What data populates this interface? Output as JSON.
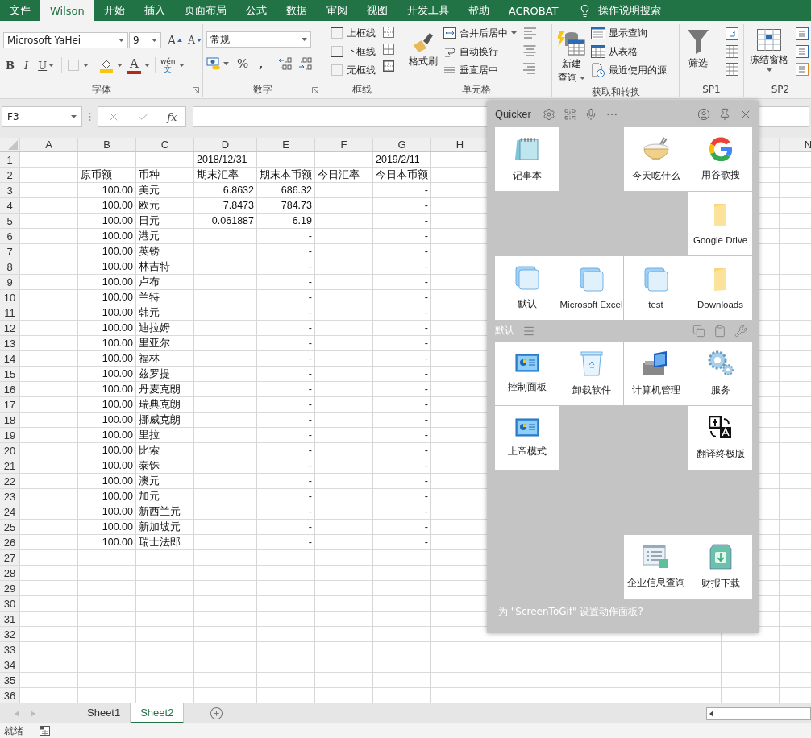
{
  "ribbon_tabs": [
    {
      "label": "文件",
      "selected": false
    },
    {
      "label": "Wilson",
      "selected": true
    },
    {
      "label": "开始",
      "selected": false
    },
    {
      "label": "插入",
      "selected": false
    },
    {
      "label": "页面布局",
      "selected": false
    },
    {
      "label": "公式",
      "selected": false
    },
    {
      "label": "数据",
      "selected": false
    },
    {
      "label": "审阅",
      "selected": false
    },
    {
      "label": "视图",
      "selected": false
    },
    {
      "label": "开发工具",
      "selected": false
    },
    {
      "label": "帮助",
      "selected": false
    },
    {
      "label": "ACROBAT",
      "selected": false
    }
  ],
  "tell_me": "操作说明搜索",
  "font_group": {
    "label": "字体",
    "font_name": "Microsoft YaHei",
    "font_size": "9",
    "grow": "A",
    "shrink": "A",
    "bold": "B",
    "italic": "I",
    "underline": "U",
    "font_color": "A",
    "phonetic": [
      "wén",
      "文"
    ]
  },
  "number_group": {
    "label": "数字",
    "format": "常规",
    "percent": "%",
    "comma": ","
  },
  "border_group": {
    "label": "框线",
    "items": [
      "上框线",
      "下框线",
      "无框线"
    ]
  },
  "cells_group": {
    "label": "单元格",
    "format_painter": "格式刷",
    "items": [
      "合并后居中",
      "自动换行",
      "垂直居中"
    ]
  },
  "get_transform_group": {
    "label": "获取和转换",
    "new_query": [
      "新建",
      "查询"
    ],
    "items": [
      "显示查询",
      "从表格",
      "最近使用的源"
    ]
  },
  "sp1_group": {
    "label": "SP1",
    "filter": "筛选"
  },
  "sp2_group": {
    "label": "SP2",
    "freeze": "冻结窗格"
  },
  "formula_bar": {
    "name_box": "F3",
    "function_label": "fx"
  },
  "grid": {
    "columns": [
      "A",
      "B",
      "C",
      "D",
      "E",
      "F",
      "G",
      "H",
      "N"
    ],
    "rows": [
      {
        "n": "1",
        "kind": "header",
        "cells": {
          "D": "2018/12/31",
          "G": "2019/2/11"
        }
      },
      {
        "n": "2",
        "kind": "header",
        "cells": {
          "B": "原币额",
          "C": "币种",
          "D": "期末汇率",
          "E": "期末本币额",
          "F": "今日汇率",
          "G": "今日本币额"
        }
      },
      {
        "n": "3",
        "kind": "data",
        "cells": {
          "B": "100.00",
          "C": "美元",
          "D": "6.8632",
          "E": "686.32",
          "G": "-"
        }
      },
      {
        "n": "4",
        "kind": "data",
        "cells": {
          "B": "100.00",
          "C": "欧元",
          "D": "7.8473",
          "E": "784.73",
          "G": "-"
        }
      },
      {
        "n": "5",
        "kind": "data",
        "cells": {
          "B": "100.00",
          "C": "日元",
          "D": "0.061887",
          "E": "6.19",
          "G": "-"
        }
      },
      {
        "n": "6",
        "kind": "data",
        "cells": {
          "B": "100.00",
          "C": "港元",
          "E": "-",
          "G": "-"
        }
      },
      {
        "n": "7",
        "kind": "data",
        "cells": {
          "B": "100.00",
          "C": "英镑",
          "E": "-",
          "G": "-"
        }
      },
      {
        "n": "8",
        "kind": "data",
        "cells": {
          "B": "100.00",
          "C": "林吉特",
          "E": "-",
          "G": "-"
        }
      },
      {
        "n": "9",
        "kind": "data",
        "cells": {
          "B": "100.00",
          "C": "卢布",
          "E": "-",
          "G": "-"
        }
      },
      {
        "n": "10",
        "kind": "data",
        "cells": {
          "B": "100.00",
          "C": "兰特",
          "E": "-",
          "G": "-"
        }
      },
      {
        "n": "11",
        "kind": "data",
        "cells": {
          "B": "100.00",
          "C": "韩元",
          "E": "-",
          "G": "-"
        }
      },
      {
        "n": "12",
        "kind": "data",
        "cells": {
          "B": "100.00",
          "C": "迪拉姆",
          "E": "-",
          "G": "-"
        }
      },
      {
        "n": "13",
        "kind": "data",
        "cells": {
          "B": "100.00",
          "C": "里亚尔",
          "E": "-",
          "G": "-"
        }
      },
      {
        "n": "14",
        "kind": "data",
        "cells": {
          "B": "100.00",
          "C": "福林",
          "E": "-",
          "G": "-"
        }
      },
      {
        "n": "15",
        "kind": "data",
        "cells": {
          "B": "100.00",
          "C": "兹罗提",
          "E": "-",
          "G": "-"
        }
      },
      {
        "n": "16",
        "kind": "data",
        "cells": {
          "B": "100.00",
          "C": "丹麦克朗",
          "E": "-",
          "G": "-"
        }
      },
      {
        "n": "17",
        "kind": "data",
        "cells": {
          "B": "100.00",
          "C": "瑞典克朗",
          "E": "-",
          "G": "-"
        }
      },
      {
        "n": "18",
        "kind": "data",
        "cells": {
          "B": "100.00",
          "C": "挪威克朗",
          "E": "-",
          "G": "-"
        }
      },
      {
        "n": "19",
        "kind": "data",
        "cells": {
          "B": "100.00",
          "C": "里拉",
          "E": "-",
          "G": "-"
        }
      },
      {
        "n": "20",
        "kind": "data",
        "cells": {
          "B": "100.00",
          "C": "比索",
          "E": "-",
          "G": "-"
        }
      },
      {
        "n": "21",
        "kind": "data",
        "cells": {
          "B": "100.00",
          "C": "泰铢",
          "E": "-",
          "G": "-"
        }
      },
      {
        "n": "22",
        "kind": "data",
        "cells": {
          "B": "100.00",
          "C": "澳元",
          "E": "-",
          "G": "-"
        }
      },
      {
        "n": "23",
        "kind": "data",
        "cells": {
          "B": "100.00",
          "C": "加元",
          "E": "-",
          "G": "-"
        }
      },
      {
        "n": "24",
        "kind": "data",
        "cells": {
          "B": "100.00",
          "C": "新西兰元",
          "E": "-",
          "G": "-"
        }
      },
      {
        "n": "25",
        "kind": "data",
        "cells": {
          "B": "100.00",
          "C": "新加坡元",
          "E": "-",
          "G": "-"
        }
      },
      {
        "n": "26",
        "kind": "data",
        "cells": {
          "B": "100.00",
          "C": "瑞士法郎",
          "E": "-",
          "G": "-"
        }
      },
      {
        "n": "27"
      },
      {
        "n": "28"
      },
      {
        "n": "29"
      },
      {
        "n": "30"
      },
      {
        "n": "31"
      },
      {
        "n": "32"
      },
      {
        "n": "33"
      },
      {
        "n": "34"
      },
      {
        "n": "35"
      },
      {
        "n": "36"
      }
    ]
  },
  "sheet_tabs": [
    {
      "label": "Sheet1",
      "selected": false
    },
    {
      "label": "Sheet2",
      "selected": true
    }
  ],
  "status": "就绪",
  "quicker": {
    "title": "Quicker",
    "top_tiles": [
      {
        "kind": "action",
        "label": "记事本"
      },
      {
        "kind": "empty"
      },
      {
        "kind": "action",
        "label": "今天吃什么"
      },
      {
        "kind": "action",
        "label": "用谷歌搜"
      },
      {
        "kind": "empty"
      },
      {
        "kind": "empty"
      },
      {
        "kind": "empty"
      },
      {
        "kind": "action",
        "label": "Google Drive"
      },
      {
        "kind": "action",
        "label": "默认"
      },
      {
        "kind": "action",
        "label": "Microsoft Excel"
      },
      {
        "kind": "action",
        "label": "test"
      },
      {
        "kind": "action",
        "label": "Downloads"
      }
    ],
    "section_label": "默认",
    "bottom_tiles": [
      {
        "kind": "action",
        "label": "控制面板"
      },
      {
        "kind": "action",
        "label": "卸载软件"
      },
      {
        "kind": "action",
        "label": "计算机管理"
      },
      {
        "kind": "action",
        "label": "服务"
      },
      {
        "kind": "action",
        "label": "上帝模式"
      },
      {
        "kind": "empty"
      },
      {
        "kind": "empty"
      },
      {
        "kind": "action",
        "label": "翻译终极版"
      },
      {
        "kind": "empty"
      },
      {
        "kind": "empty"
      },
      {
        "kind": "empty"
      },
      {
        "kind": "empty"
      },
      {
        "kind": "empty"
      },
      {
        "kind": "empty"
      },
      {
        "kind": "action",
        "label": "企业信息查询"
      },
      {
        "kind": "action",
        "label": "财报下载"
      }
    ],
    "footer": "为 \"ScreenToGif\" 设置动作面板?"
  }
}
